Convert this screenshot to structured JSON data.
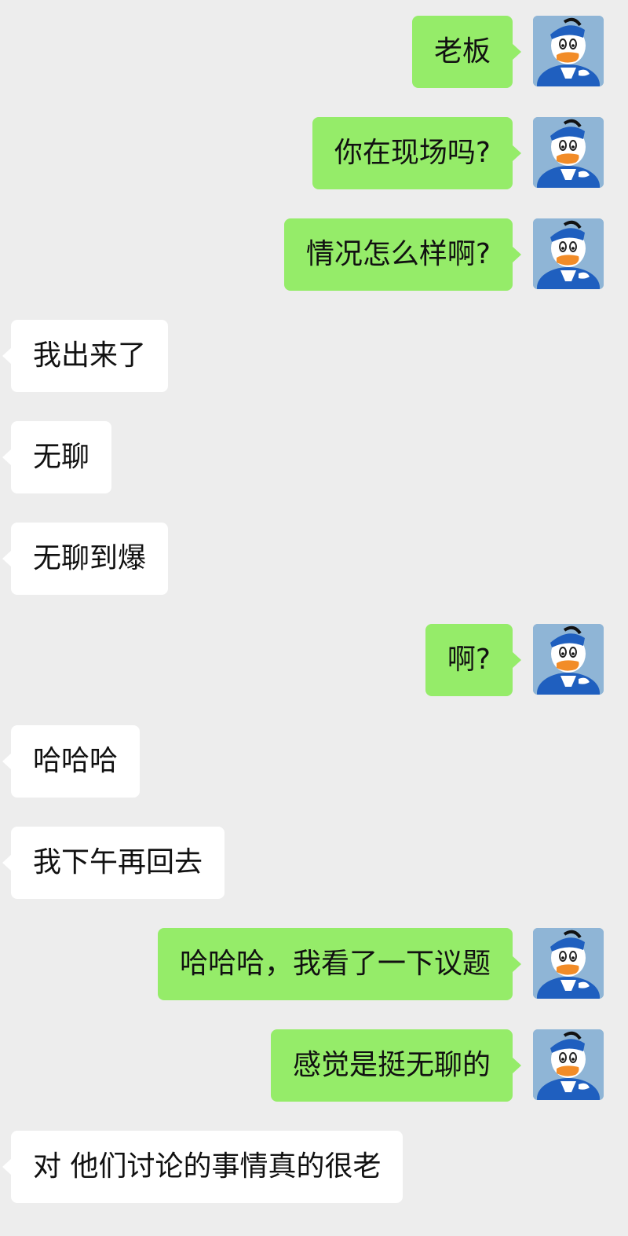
{
  "conversation": {
    "messages": [
      {
        "sender": "me",
        "text": "老板"
      },
      {
        "sender": "me",
        "text": "你在现场吗?"
      },
      {
        "sender": "me",
        "text": "情况怎么样啊?"
      },
      {
        "sender": "them",
        "text": "我出来了"
      },
      {
        "sender": "them",
        "text": "无聊"
      },
      {
        "sender": "them",
        "text": "无聊到爆"
      },
      {
        "sender": "me",
        "text": "啊?"
      },
      {
        "sender": "them",
        "text": "哈哈哈"
      },
      {
        "sender": "them",
        "text": "我下午再回去"
      },
      {
        "sender": "me",
        "text": "哈哈哈，我看了一下议题"
      },
      {
        "sender": "me",
        "text": "感觉是挺无聊的"
      },
      {
        "sender": "them",
        "text": "对 他们讨论的事情真的很老"
      }
    ]
  },
  "theme": {
    "background": "#ededed",
    "outgoing_bubble": "#95ec69",
    "incoming_bubble": "#ffffff",
    "text_color": "#111111"
  },
  "icons": {
    "my_avatar": "cartoon-duck-avatar-icon"
  }
}
